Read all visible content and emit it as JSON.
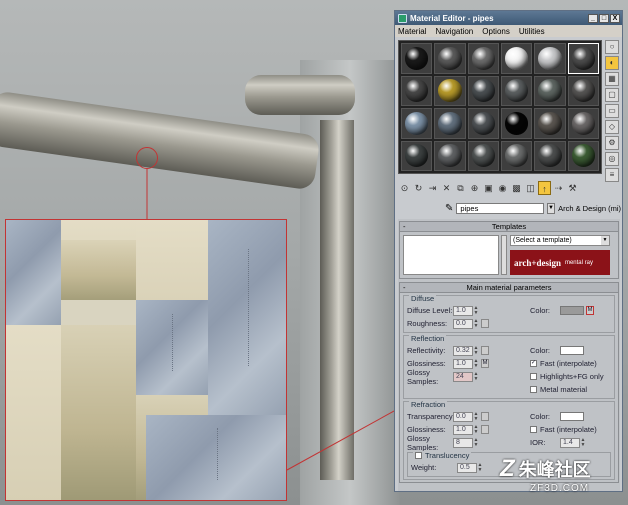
{
  "window": {
    "title": "Material Editor - pipes",
    "buttons": [
      "_",
      "□",
      "X"
    ]
  },
  "menu": [
    "Material",
    "Navigation",
    "Options",
    "Utilities"
  ],
  "slot_colors": [
    "#1a1a1a",
    "#5a5a5a",
    "#6c6c6c",
    "#f4f4f4",
    "#c9cacc",
    "#4c4c4c",
    "#474747",
    "#b79a2a",
    "#4a4f52",
    "#5b5f60",
    "#5e6662",
    "#555453",
    "#7e93a8",
    "#62707e",
    "#4e5255",
    "#050505",
    "#5a5550",
    "#6b6868",
    "#3d4242",
    "#5f6163",
    "#505454",
    "#6b6d6d",
    "#4c4e4e",
    "#3c5c34"
  ],
  "material": {
    "name": "pipes",
    "type": "Arch & Design (mi)"
  },
  "templates": {
    "title": "Templates",
    "select": "(Select a template)",
    "logo": "arch+design",
    "logo_sub": "mental ray"
  },
  "main": {
    "title": "Main material parameters",
    "diffuse": {
      "title": "Diffuse",
      "level_label": "Diffuse Level:",
      "level": "1.0",
      "roughness_label": "Roughness:",
      "roughness": "0.0",
      "color_label": "Color:",
      "map": "M"
    },
    "reflection": {
      "title": "Reflection",
      "reflectivity_label": "Reflectivity:",
      "reflectivity": "0.32",
      "glossiness_label": "Glossiness:",
      "glossiness": "1.0",
      "glossiness_map": "M",
      "samples_label": "Glossy Samples:",
      "samples": "24",
      "color_label": "Color:",
      "fast_label": "Fast (interpolate)",
      "highlights_label": "Highlights+FG only",
      "metal_label": "Metal material"
    },
    "refraction": {
      "title": "Refraction",
      "transparency_label": "Transparency:",
      "transparency": "0.0",
      "glossiness_label": "Glossiness:",
      "glossiness": "1.0",
      "samples_label": "Glossy Samples:",
      "samples": "8",
      "color_label": "Color:",
      "fast_label": "Fast (interpolate)",
      "ior_label": "IOR:",
      "ior": "1.4"
    },
    "translucency": {
      "label": "Translucency",
      "weight_label": "Weight:",
      "weight": "0.5"
    }
  },
  "watermark": {
    "text": "朱峰社区",
    "url": "ZF3D.COM"
  }
}
